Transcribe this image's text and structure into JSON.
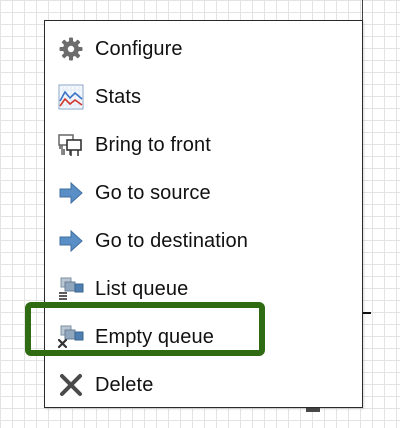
{
  "menu": {
    "items": [
      {
        "label": "Configure",
        "icon": "gear-icon"
      },
      {
        "label": "Stats",
        "icon": "chart-icon"
      },
      {
        "label": "Bring to front",
        "icon": "bring-front-icon"
      },
      {
        "label": "Go to source",
        "icon": "arrow-right-icon"
      },
      {
        "label": "Go to destination",
        "icon": "arrow-right-icon"
      },
      {
        "label": "List queue",
        "icon": "list-queue-icon"
      },
      {
        "label": "Empty queue",
        "icon": "empty-queue-icon"
      },
      {
        "label": "Delete",
        "icon": "delete-x-icon"
      }
    ],
    "highlighted_item": "Empty queue"
  },
  "colors": {
    "highlight": "#2e6b12",
    "arrow": "#4f81b8",
    "grid": "#e3e3e3"
  }
}
